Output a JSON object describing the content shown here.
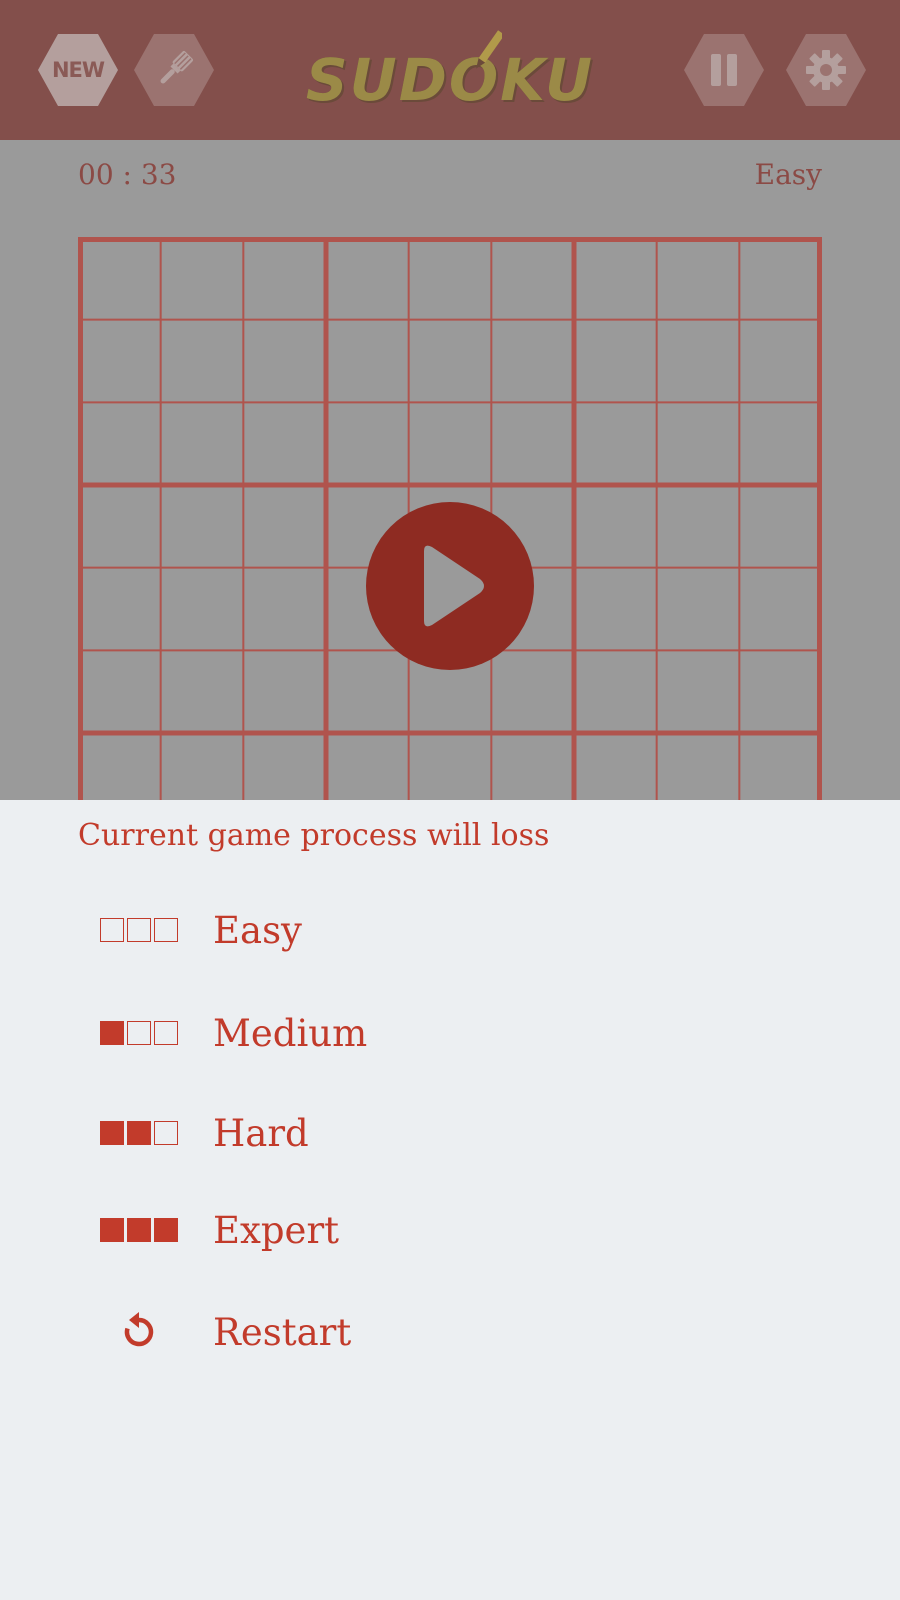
{
  "header": {
    "new_badge": "NEW",
    "logo_text": "SUDOKU",
    "buttons": [
      "new-game",
      "theme-brush",
      "pause",
      "settings"
    ]
  },
  "status": {
    "timer": "00 : 33",
    "difficulty": "Easy"
  },
  "board": {
    "rows": 9,
    "cols": 9,
    "cells_visible": "empty"
  },
  "dialog": {
    "warning": "Current game process will loss",
    "options": [
      {
        "label": "Easy",
        "level": 0
      },
      {
        "label": "Medium",
        "level": 1
      },
      {
        "label": "Hard",
        "level": 2
      },
      {
        "label": "Expert",
        "level": 3
      },
      {
        "label": "Restart",
        "icon": "restart-icon"
      }
    ]
  },
  "colors": {
    "header_bg": "#834f4b",
    "accent_red": "#c23b2b",
    "grid_line": "#b0544d",
    "play_button": "#8e2b22",
    "logo_gold": "#9b8a47",
    "sheet_bg": "#eceff2",
    "overlay_gray": "#9a9a9a"
  }
}
